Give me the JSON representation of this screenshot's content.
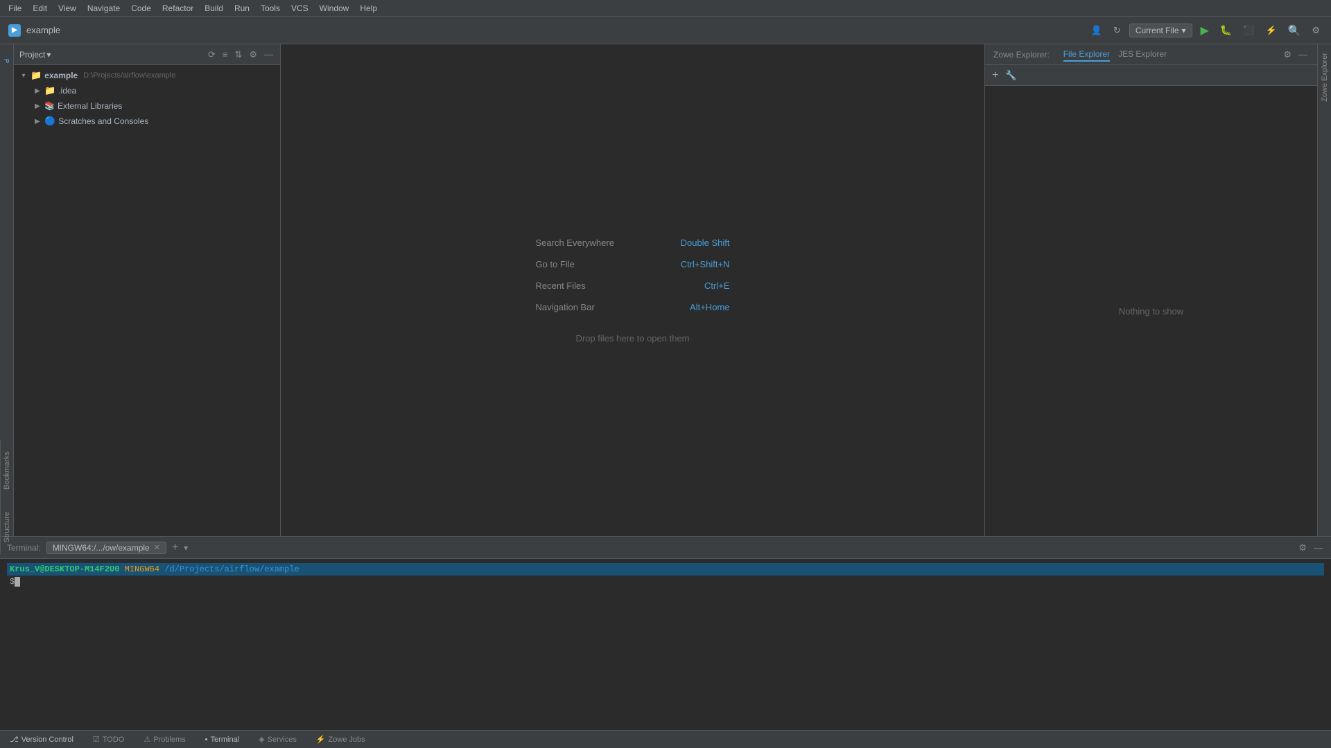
{
  "app": {
    "title": "example",
    "logo_text": "▶"
  },
  "menu": {
    "items": [
      "File",
      "Edit",
      "View",
      "Navigate",
      "Code",
      "Refactor",
      "Build",
      "Run",
      "Tools",
      "VCS",
      "Window",
      "Help"
    ]
  },
  "toolbar": {
    "run_config": "Current File",
    "run_config_arrow": "▾"
  },
  "project_panel": {
    "title": "Project",
    "root": {
      "name": "example",
      "path": "D:\\Projects/airflow\\example",
      "children": [
        {
          "name": ".idea",
          "type": "folder"
        },
        {
          "name": "External Libraries",
          "type": "library"
        },
        {
          "name": "Scratches and Consoles",
          "type": "scratch"
        }
      ]
    }
  },
  "editor": {
    "shortcuts": [
      {
        "label": "Search Everywhere",
        "key": "Double Shift"
      },
      {
        "label": "Go to File",
        "key": "Ctrl+Shift+N"
      },
      {
        "label": "Recent Files",
        "key": "Ctrl+E"
      },
      {
        "label": "Navigation Bar",
        "key": "Alt+Home"
      }
    ],
    "drop_hint": "Drop files here to open them"
  },
  "zowe_panel": {
    "label": "Zowe Explorer:",
    "tabs": [
      {
        "name": "File Explorer",
        "active": true
      },
      {
        "name": "JES Explorer",
        "active": false
      }
    ],
    "nothing_to_show": "Nothing to show"
  },
  "terminal": {
    "label": "Terminal:",
    "tab_name": "MINGW64:/.../ow/example",
    "prompt_user": "Krus_V@DESKTOP-M14F2U0",
    "prompt_host": "MINGW64",
    "prompt_path": "/d/Projects/airflow/example",
    "line2": "$ "
  },
  "status_bar": {
    "items": [
      {
        "icon": "git-icon",
        "label": "Version Control"
      },
      {
        "icon": "todo-icon",
        "label": "TODO"
      },
      {
        "icon": "problems-icon",
        "label": "Problems"
      },
      {
        "icon": "terminal-icon",
        "label": "Terminal"
      },
      {
        "icon": "services-icon",
        "label": "Services"
      },
      {
        "icon": "zowe-icon",
        "label": "Zowe Jobs"
      }
    ]
  },
  "right_sidebar": {
    "label": "Zowe Explorer"
  },
  "left_sidebar": {
    "labels": [
      "Structure",
      "Bookmarks"
    ]
  },
  "icons": {
    "folder": "📁",
    "idea": "📁",
    "scratch": "🔵",
    "library": "📚",
    "search": "🔍",
    "gear": "⚙",
    "close": "✕",
    "plus": "+",
    "arrow_down": "▾",
    "collapse": "—"
  }
}
